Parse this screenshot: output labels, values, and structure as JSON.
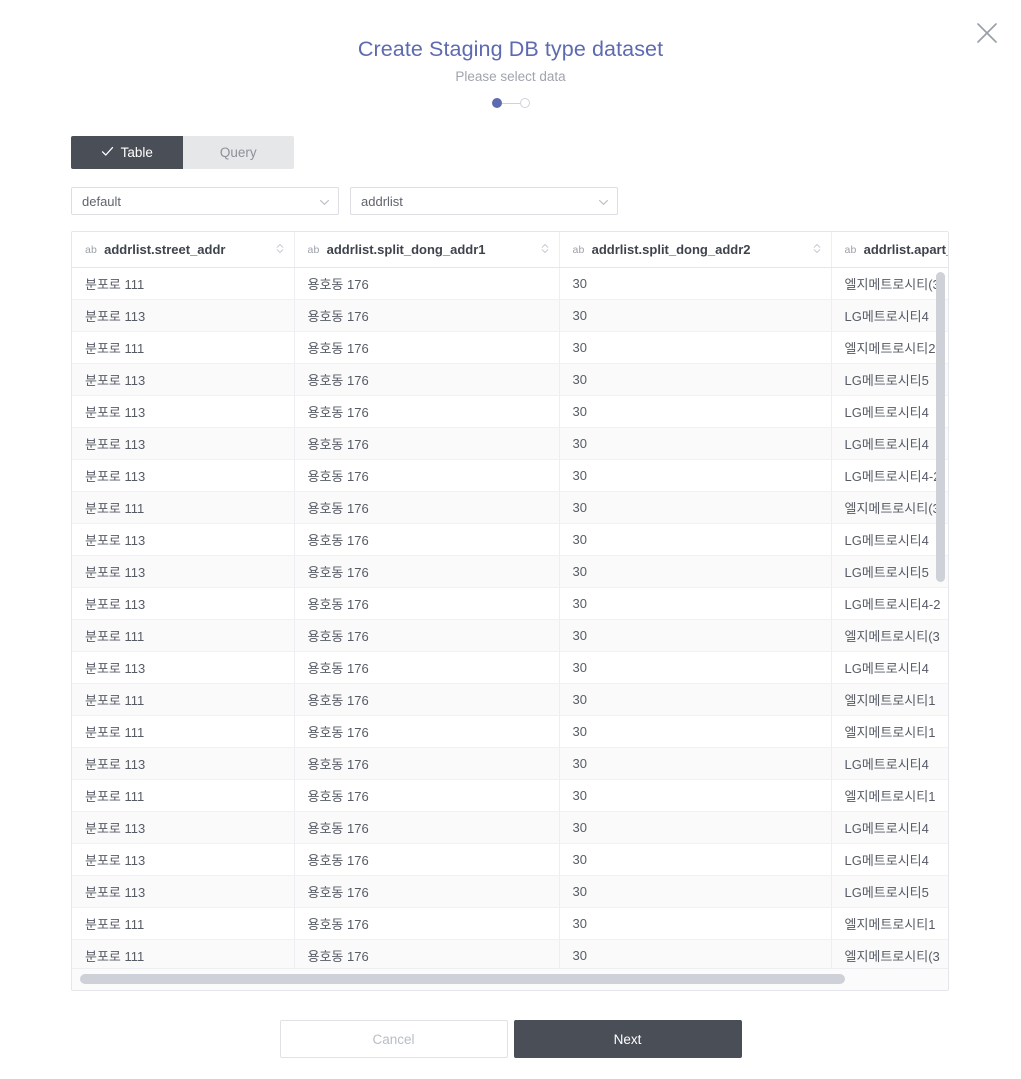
{
  "dialog": {
    "title": "Create Staging DB type dataset",
    "subtitle": "Please select data",
    "close_icon": "close-icon"
  },
  "steps": {
    "current": 1,
    "total": 2,
    "items": [
      {
        "index": 1,
        "state": "active"
      },
      {
        "index": 2,
        "state": "inactive"
      }
    ]
  },
  "tabs": [
    {
      "label": "Table",
      "active": true,
      "icon": "check-icon"
    },
    {
      "label": "Query",
      "active": false,
      "icon": ""
    }
  ],
  "selectors": {
    "schema": {
      "value": "default",
      "placeholder": "default",
      "icon": "chevron-down-icon"
    },
    "table": {
      "value": "addrlist",
      "placeholder": "addrlist",
      "icon": "chevron-down-icon"
    }
  },
  "table": {
    "columns": [
      {
        "type_badge": "ab",
        "name": "addrlist.street_addr",
        "sort_icon": "sort-icon"
      },
      {
        "type_badge": "ab",
        "name": "addrlist.split_dong_addr1",
        "sort_icon": "sort-icon"
      },
      {
        "type_badge": "ab",
        "name": "addrlist.split_dong_addr2",
        "sort_icon": "sort-icon"
      },
      {
        "type_badge": "ab",
        "name": "addrlist.apart_",
        "sort_icon": "sort-icon"
      }
    ],
    "rows": [
      [
        "분포로 111",
        "용호동 176",
        "30",
        "엘지메트로시티(3"
      ],
      [
        "분포로 113",
        "용호동 176",
        "30",
        "LG메트로시티4"
      ],
      [
        "분포로 111",
        "용호동 176",
        "30",
        "엘지메트로시티2"
      ],
      [
        "분포로 113",
        "용호동 176",
        "30",
        "LG메트로시티5"
      ],
      [
        "분포로 113",
        "용호동 176",
        "30",
        "LG메트로시티4"
      ],
      [
        "분포로 113",
        "용호동 176",
        "30",
        "LG메트로시티4"
      ],
      [
        "분포로 113",
        "용호동 176",
        "30",
        "LG메트로시티4-2"
      ],
      [
        "분포로 111",
        "용호동 176",
        "30",
        "엘지메트로시티(3"
      ],
      [
        "분포로 113",
        "용호동 176",
        "30",
        "LG메트로시티4"
      ],
      [
        "분포로 113",
        "용호동 176",
        "30",
        "LG메트로시티5"
      ],
      [
        "분포로 113",
        "용호동 176",
        "30",
        "LG메트로시티4-2"
      ],
      [
        "분포로 111",
        "용호동 176",
        "30",
        "엘지메트로시티(3"
      ],
      [
        "분포로 113",
        "용호동 176",
        "30",
        "LG메트로시티4"
      ],
      [
        "분포로 111",
        "용호동 176",
        "30",
        "엘지메트로시티1"
      ],
      [
        "분포로 111",
        "용호동 176",
        "30",
        "엘지메트로시티1"
      ],
      [
        "분포로 113",
        "용호동 176",
        "30",
        "LG메트로시티4"
      ],
      [
        "분포로 111",
        "용호동 176",
        "30",
        "엘지메트로시티1"
      ],
      [
        "분포로 113",
        "용호동 176",
        "30",
        "LG메트로시티4"
      ],
      [
        "분포로 113",
        "용호동 176",
        "30",
        "LG메트로시티4"
      ],
      [
        "분포로 113",
        "용호동 176",
        "30",
        "LG메트로시티5"
      ],
      [
        "분포로 111",
        "용호동 176",
        "30",
        "엘지메트로시티1"
      ],
      [
        "분포로 111",
        "용호동 176",
        "30",
        "엘지메트로시티(3"
      ]
    ],
    "vertical_scrollbar": {
      "name": "vertical-scrollbar"
    },
    "horizontal_scrollbar": {
      "name": "horizontal-scrollbar"
    }
  },
  "footer": {
    "cancel_label": "Cancel",
    "next_label": "Next"
  },
  "colors": {
    "title": "#5e6ab0",
    "accent": "#5e6ab0",
    "tab_active_bg": "#4a4e57",
    "tab_inactive_bg": "#e6e7e9",
    "next_bg": "#4a4e57",
    "scrollbar": "#cfd1d8",
    "row_alt_bg": "#fafafb"
  }
}
